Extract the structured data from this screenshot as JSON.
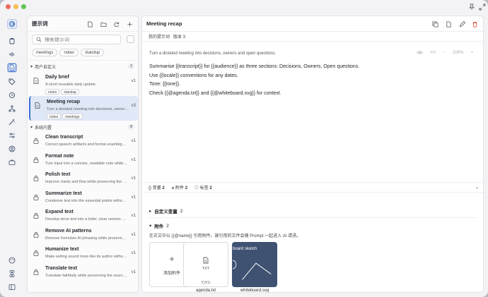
{
  "window": {
    "traffic_lights": [
      "#ee6a5f",
      "#f5be4f",
      "#61c454"
    ]
  },
  "titlebar_icons": [
    "pin-icon",
    "expand-icon"
  ],
  "rail": {
    "top": [
      "app-logo-icon",
      "clipboard-icon",
      "waveform-icon",
      "document-icon",
      "tag-icon",
      "history-icon",
      "network-icon",
      "magic-icon",
      "sliders-icon",
      "account-icon",
      "briefcase-icon"
    ],
    "bottom": [
      "palette-icon",
      "command-icon",
      "sidebar-toggle-icon"
    ],
    "active": "document-icon"
  },
  "sidebar": {
    "title": "提示词",
    "search_placeholder": "搜索提示词",
    "filter_tags": [
      "meetings",
      "notes",
      "standup"
    ],
    "sections": [
      {
        "title": "用户自定义",
        "count": "2",
        "items": [
          {
            "name": "Daily brief",
            "desc": "A short reusable daily update.",
            "version": "v1",
            "tags": [
              "notes",
              "standup"
            ]
          },
          {
            "name": "Meeting recap",
            "desc": "Turn a dictated meeting into decisions, owners a...",
            "version": "v3",
            "tags": [
              "notes",
              "meetings"
            ]
          }
        ]
      },
      {
        "title": "系统内置",
        "count": "8",
        "items": [
          {
            "name": "Clean transcript",
            "desc": "Correct speech artifacts and format unambiguou...",
            "version": "v1"
          },
          {
            "name": "Format note",
            "desc": "Turn input into a concise, readable note while pre...",
            "version": "v1"
          },
          {
            "name": "Polish text",
            "desc": "Improve clarity and flow while preserving the orig...",
            "version": "v1"
          },
          {
            "name": "Summarize text",
            "desc": "Condense text into the essential points without a...",
            "version": "v1"
          },
          {
            "name": "Expand text",
            "desc": "Develop terse text into a fuller, clear version with...",
            "version": "v1"
          },
          {
            "name": "Remove AI patterns",
            "desc": "Remove formulaic AI phrasing while preserving th...",
            "version": "v1"
          },
          {
            "name": "Humanize text",
            "desc": "Make writing sound more like its author without in...",
            "version": "v1"
          },
          {
            "name": "Translate text",
            "desc": "Translate faithfully while preserving the source te...",
            "version": "v1"
          }
        ]
      }
    ]
  },
  "main": {
    "title": "Meeting recap",
    "breadcrumb": [
      "我的提示词",
      "版本 3"
    ],
    "description": "Turn a dictated meeting into decisions, owners and open questions.",
    "zoom": "100%",
    "body_lines": [
      "Summarise {{transcript}} for {{audience}} as three sections: Decisions, Owners, Open questions.",
      "Use {{locale}} conventions for any dates.",
      "Tone: {{tone}}.",
      "Check {{@agenda.txt}} and {{@whiteboard.svg}} for context."
    ],
    "stats": {
      "variables_label": "变量",
      "variables_count": "2",
      "attachments_label": "附件",
      "attachments_count": "2",
      "tags_label": "标签",
      "tags_count": "2"
    },
    "custom_vars": {
      "label": "自定义变量",
      "count": "2"
    },
    "attachments": {
      "label": "附件",
      "count": "2",
      "hint": "在正文中以 {{@name}} 引用附件。被引用的文件会随 Prompt 一起进入 AI 请求。",
      "add_label": "添加附件",
      "files": [
        {
          "name": "agenda.txt",
          "type_label": "TXT",
          "sub": "无预览"
        },
        {
          "name": "whiteboard.svg",
          "preview_title": "board sketch"
        }
      ]
    }
  }
}
